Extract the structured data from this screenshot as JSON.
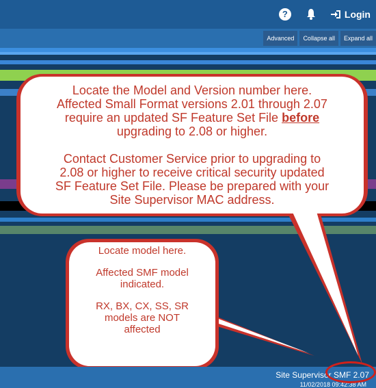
{
  "header": {
    "help_icon": "?",
    "notifications_icon": "bell",
    "login_label": "Login"
  },
  "toolbar": {
    "advanced_label": "Advanced",
    "collapse_label": "Collapse all",
    "expand_label": "Expand all"
  },
  "callout_main": {
    "line1": "Locate the Model and Version number here.",
    "line2": "Affected Small Format versions 2.01 through 2.07",
    "line3a": "require an updated SF Feature Set File ",
    "line3b": "before",
    "line4": "upgrading to 2.08 or higher.",
    "line5": "Contact  Customer Service prior to upgrading to",
    "line6": "2.08 or higher to receive critical security updated",
    "line7": "SF Feature Set File.  Please be prepared with your",
    "line8": "Site Supervisor MAC address."
  },
  "callout_model": {
    "line1": "Locate model here.",
    "line2": "Affected SMF model",
    "line3": "indicated.",
    "line4": "RX, BX, CX, SS, SR",
    "line5": "models are NOT",
    "line6": "affected"
  },
  "footer": {
    "product_version": "Site Supervisor SMF 2.07",
    "timestamp": "11/02/2018 09:42:38 AM"
  },
  "colors": {
    "accent_red": "#c9322b",
    "header_blue": "#1e5b95",
    "background": "#143d63"
  }
}
